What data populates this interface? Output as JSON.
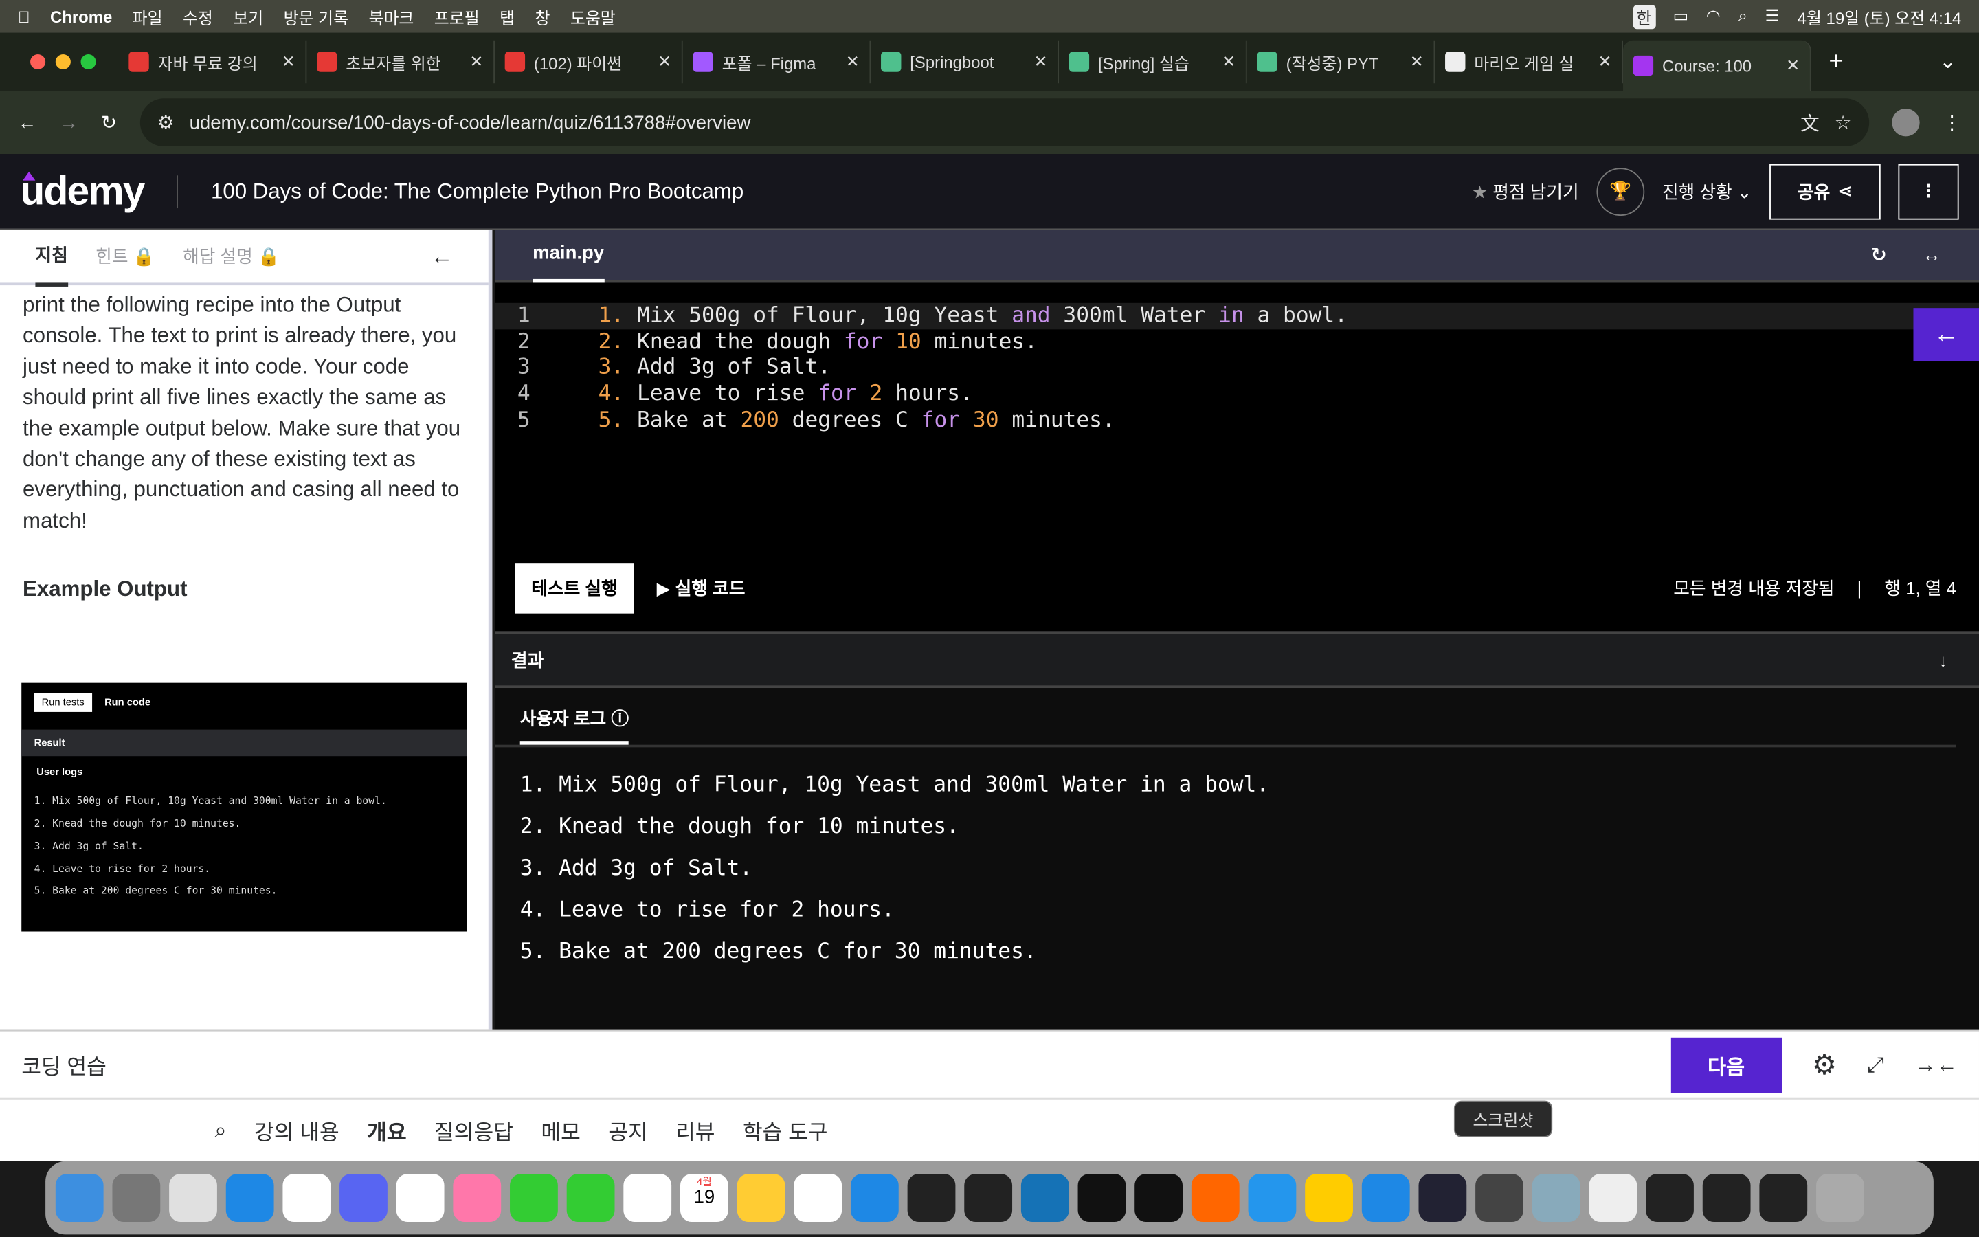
{
  "menubar": {
    "app": "Chrome",
    "items": [
      "파일",
      "수정",
      "보기",
      "방문 기록",
      "북마크",
      "프로필",
      "탭",
      "창",
      "도움말"
    ],
    "ime": "한",
    "clock": "4월 19일 (토) 오전 4:14"
  },
  "tabs": [
    {
      "title": "자바 무료 강의",
      "color": "#e53935"
    },
    {
      "title": "초보자를 위한",
      "color": "#e53935"
    },
    {
      "title": "(102) 파이썬",
      "color": "#e53935"
    },
    {
      "title": "포폴 – Figma",
      "color": "#a259ff"
    },
    {
      "title": "[Springboot",
      "color": "#4fc08d"
    },
    {
      "title": "[Spring] 실습",
      "color": "#4fc08d"
    },
    {
      "title": "(작성중) PYT",
      "color": "#4fc08d"
    },
    {
      "title": "마리오 게임 실",
      "color": "#eeeeee"
    },
    {
      "title": "Course: 100",
      "color": "#a435f0"
    }
  ],
  "url": "udemy.com/course/100-days-of-code/learn/quiz/6113788#overview",
  "header": {
    "logo": "udemy",
    "course_title": "100 Days of Code: The Complete Python Pro Bootcamp",
    "rate": "평점 남기기",
    "progress": "진행 상황",
    "share": "공유"
  },
  "left": {
    "tabs": [
      "지침",
      "힌트",
      "해답 설명"
    ],
    "instructions": "print the following recipe into the Output console. The text to print is already there, you just need to make it into code. Your code should print all five lines exactly the same as the example output below. Make sure that you don't change any of these existing text as everything, punctuation and casing all need to match!",
    "example_heading": "Example Output",
    "example": {
      "run_tests": "Run tests",
      "run_code": "Run code",
      "result": "Result",
      "user_logs": "User logs",
      "lines": [
        "1. Mix 500g of Flour, 10g Yeast and 300ml Water in a bowl.",
        "2. Knead the dough for 10 minutes.",
        "3. Add 3g of Salt.",
        "4. Leave to rise for 2 hours.",
        "5. Bake at 200 degrees C for 30 minutes."
      ]
    }
  },
  "editor": {
    "filename": "main.py",
    "line_numbers": [
      "1",
      "2",
      "3",
      "4",
      "5"
    ],
    "test_button": "테스트 실행",
    "run_button": "실행 코드",
    "saved": "모든 변경 내용 저장됨",
    "position": "행 1, 열 4"
  },
  "result": {
    "title": "결과",
    "tab": "사용자 로그",
    "lines": [
      "1. Mix 500g of Flour, 10g Yeast and 300ml Water in a bowl.",
      "2. Knead the dough for 10 minutes.",
      "3. Add 3g of Salt.",
      "4. Leave to rise for 2 hours.",
      "5. Bake at 200 degrees C for 30 minutes."
    ]
  },
  "bottom": {
    "label": "코딩 연습",
    "next": "다음"
  },
  "nav": [
    "강의 내용",
    "개요",
    "질의응답",
    "메모",
    "공지",
    "리뷰",
    "학습 도구"
  ],
  "tooltip": "스크린샷",
  "dock_calendar": {
    "month": "4월",
    "day": "19"
  }
}
